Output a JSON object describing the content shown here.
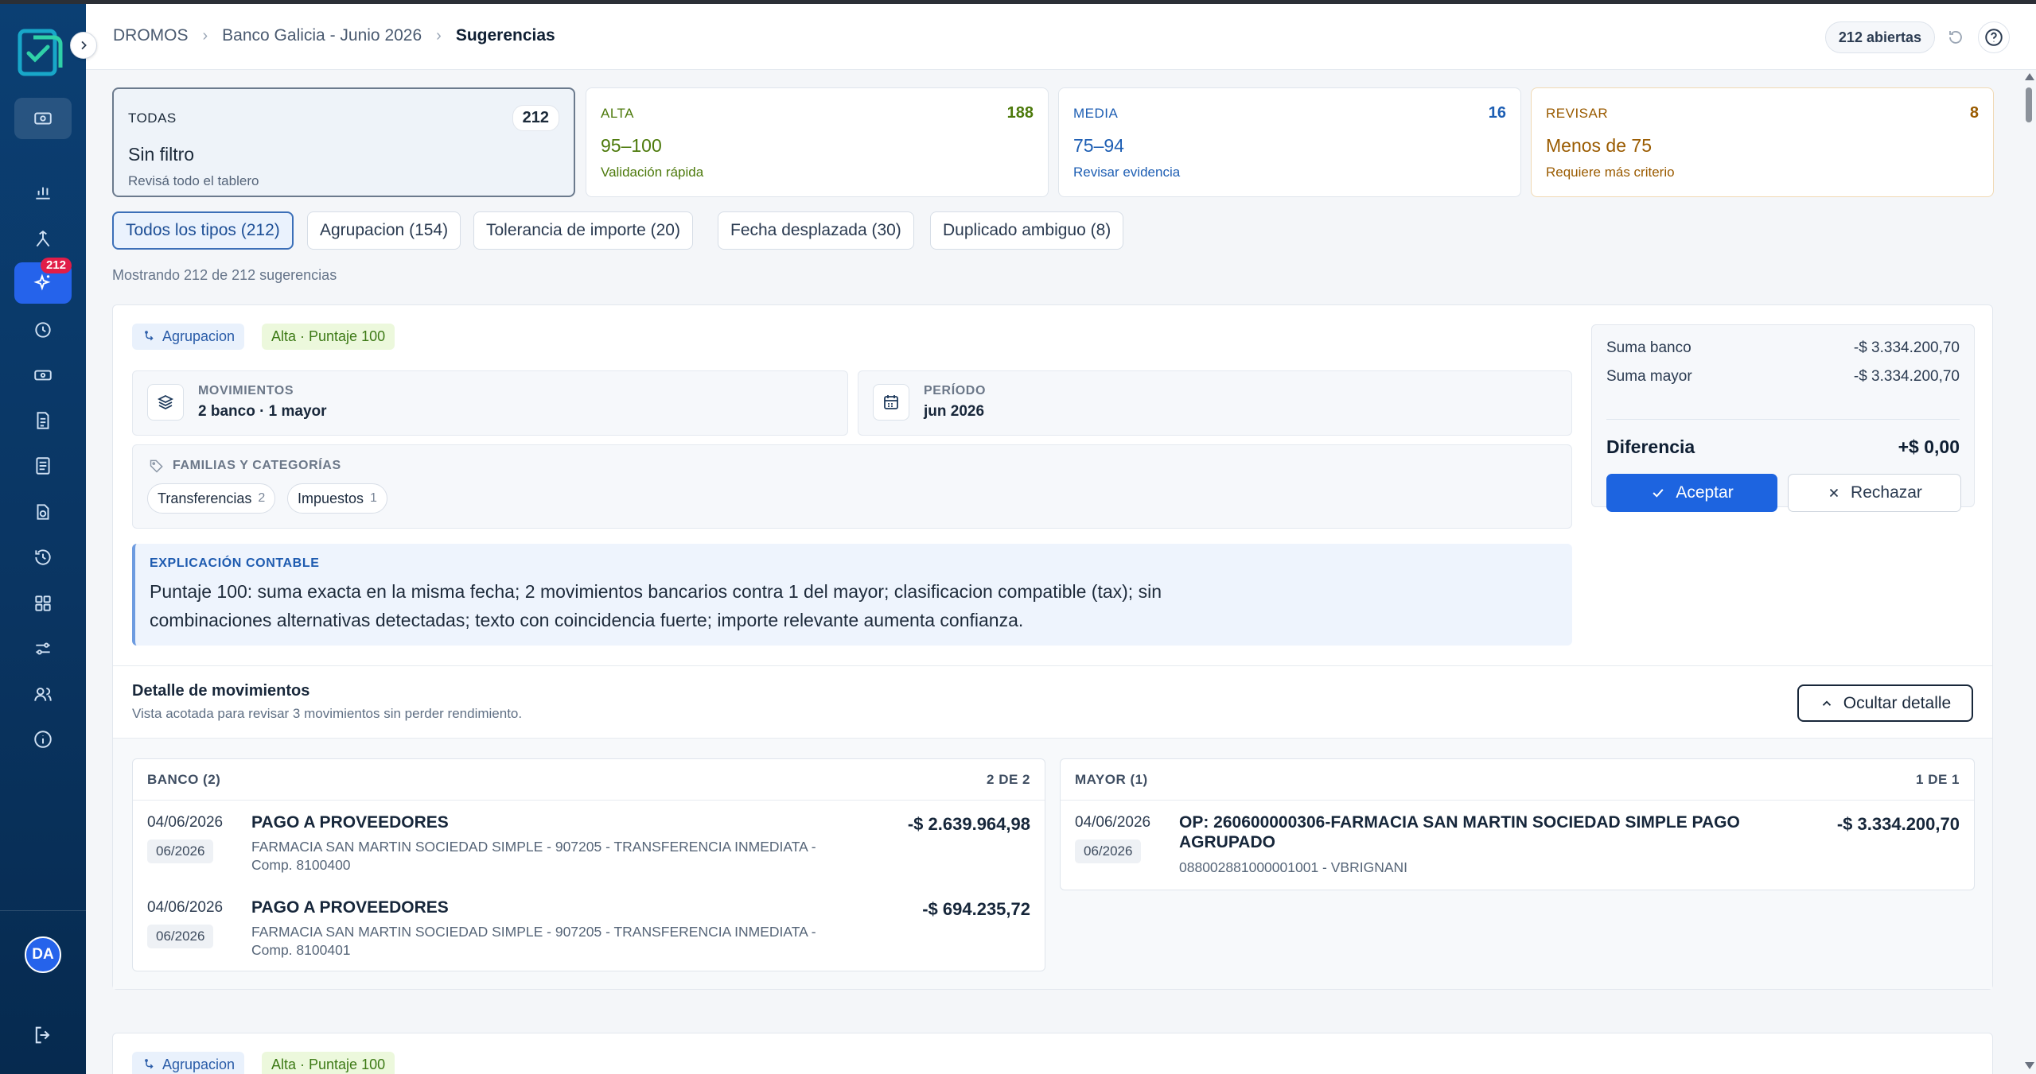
{
  "header": {
    "breadcrumb": [
      "DROMOS",
      "Banco Galicia - Junio 2026",
      "Sugerencias"
    ],
    "open_count": "212 abiertas"
  },
  "sidebar": {
    "badge": "212",
    "avatar": "DA",
    "items": [
      "bank-icon",
      "chart-icon",
      "merge-icon",
      "sparkle-icon",
      "clock-icon",
      "money-icon",
      "invoice-icon",
      "ledger-icon",
      "rotate-icon",
      "history-icon",
      "grid-icon",
      "sliders-icon",
      "users-icon",
      "info-icon"
    ]
  },
  "filters": [
    {
      "label": "TODAS",
      "count": "212",
      "title": "Sin filtro",
      "sub": "Revisá todo el tablero",
      "color": "#1c2a3a"
    },
    {
      "label": "ALTA",
      "count": "188",
      "title": "95–100",
      "sub": "Validación rápida",
      "color": "#4d7a0c"
    },
    {
      "label": "MEDIA",
      "count": "16",
      "title": "75–94",
      "sub": "Revisar evidencia",
      "color": "#1d5eb3"
    },
    {
      "label": "REVISAR",
      "count": "8",
      "title": "Menos de 75",
      "sub": "Requiere más criterio",
      "color": "#9a5b00"
    }
  ],
  "type_chips": [
    "Todos los tipos (212)",
    "Agrupacion (154)",
    "Tolerancia de importe (20)",
    "Fecha desplazada (30)",
    "Duplicado ambiguo (8)"
  ],
  "showing": "Mostrando 212 de 212 sugerencias",
  "suggestion": {
    "type_tag": "Agrupacion",
    "score_tag": "Alta · Puntaje 100",
    "movimientos_label": "MOVIMIENTOS",
    "movimientos_value": "2 banco · 1 mayor",
    "periodo_label": "PERÍODO",
    "periodo_value": "jun 2026",
    "families_label": "FAMILIAS Y CATEGORÍAS",
    "families": [
      {
        "name": "Transferencias",
        "count": "2"
      },
      {
        "name": "Impuestos",
        "count": "1"
      }
    ],
    "explain_label": "EXPLICACIÓN CONTABLE",
    "explain_text": "Puntaje 100: suma exacta en la misma fecha; 2 movimientos bancarios contra 1 del mayor; clasificacion compatible (tax); sin combinaciones alternativas detectadas; texto con coincidencia fuerte; importe relevante aumenta confianza.",
    "sum_bank_label": "Suma banco",
    "sum_bank_value": "-$ 3.334.200,70",
    "sum_mayor_label": "Suma mayor",
    "sum_mayor_value": "-$ 3.334.200,70",
    "diff_label": "Diferencia",
    "diff_value": "+$ 0,00",
    "accept_label": "Aceptar",
    "reject_label": "Rechazar",
    "detail_title": "Detalle de movimientos",
    "detail_sub": "Vista acotada para revisar 3 movimientos sin perder rendimiento.",
    "hide_label": "Ocultar detalle",
    "bank_header": "BANCO (2)",
    "bank_count": "2 DE 2",
    "mayor_header": "MAYOR (1)",
    "mayor_count": "1 DE 1",
    "bank_rows": [
      {
        "date": "04/06/2026",
        "period": "06/2026",
        "title": "PAGO A PROVEEDORES",
        "desc": "FARMACIA SAN MARTIN SOCIEDAD SIMPLE - 907205 - TRANSFERENCIA INMEDIATA - Comp. 8100400",
        "amount": "-$ 2.639.964,98"
      },
      {
        "date": "04/06/2026",
        "period": "06/2026",
        "title": "PAGO A PROVEEDORES",
        "desc": "FARMACIA SAN MARTIN SOCIEDAD SIMPLE - 907205 - TRANSFERENCIA INMEDIATA - Comp. 8100401",
        "amount": "-$ 694.235,72"
      }
    ],
    "mayor_rows": [
      {
        "date": "04/06/2026",
        "period": "06/2026",
        "title": "OP: 260600000306-FARMACIA SAN MARTIN SOCIEDAD SIMPLE PAGO AGRUPADO",
        "desc": "088002881000001001 - VBRIGNANI",
        "amount": "-$ 3.334.200,70"
      }
    ]
  },
  "next_suggestion": {
    "type_tag": "Agrupacion",
    "score_tag": "Alta · Puntaje 100"
  }
}
